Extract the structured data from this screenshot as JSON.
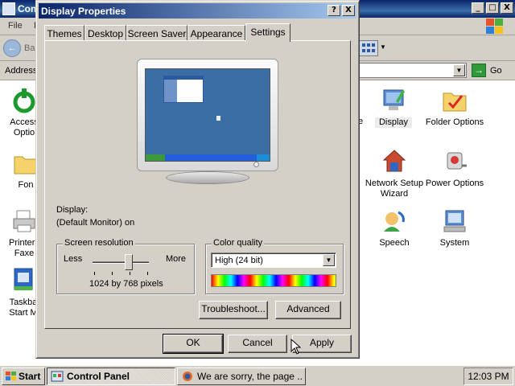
{
  "control_panel": {
    "title": "Contr",
    "menu": {
      "file": "File",
      "edit_fragment": "E"
    },
    "toolbar": {
      "back_label": "Ba"
    },
    "address": {
      "label": "Address",
      "go_label": "Go"
    },
    "items": [
      {
        "key": "accessibility",
        "label_line1": "Access",
        "label_line2": "Optio",
        "icon": "accessibility-icon"
      },
      {
        "key": "fonts",
        "label_line1": "Fon",
        "label_line2": "",
        "icon": "fonts-folder-icon"
      },
      {
        "key": "printers",
        "label_line1": "Printers",
        "label_line2": "Faxe",
        "icon": "printers-icon"
      },
      {
        "key": "taskbar",
        "label_line1": "Taskba",
        "label_line2": "Start M",
        "icon": "taskbar-icon"
      },
      {
        "key": "display",
        "label_line1": "Display",
        "label_line2": "",
        "icon": "display-icon",
        "selected": true
      },
      {
        "key": "folder_options",
        "label_line1": "Folder Options",
        "label_line2": "",
        "icon": "folder-options-icon"
      },
      {
        "key": "network_setup",
        "label_line1": "Network Setup",
        "label_line2": "Wizard",
        "icon": "network-setup-icon"
      },
      {
        "key": "power_options",
        "label_line1": "Power Options",
        "label_line2": "",
        "icon": "power-options-icon"
      },
      {
        "key": "speech",
        "label_line1": "Speech",
        "label_line2": "",
        "icon": "speech-icon"
      },
      {
        "key": "system",
        "label_line1": "System",
        "label_line2": "",
        "icon": "system-icon"
      },
      {
        "key": "partial_e",
        "label_line1": "e",
        "label_line2": "",
        "icon": ""
      }
    ]
  },
  "dialog": {
    "title": "Display Properties",
    "help_btn": "?",
    "close_btn": "X",
    "tabs": [
      "Themes",
      "Desktop",
      "Screen Saver",
      "Appearance",
      "Settings"
    ],
    "active_tab": "Settings",
    "display_label": "Display:",
    "display_value": "(Default Monitor) on",
    "screen_resolution": {
      "legend": "Screen resolution",
      "less": "Less",
      "more": "More",
      "value": "1024 by 768 pixels"
    },
    "color_quality": {
      "legend": "Color quality",
      "selected": "High (24 bit)"
    },
    "buttons": {
      "troubleshoot": "Troubleshoot...",
      "advanced": "Advanced",
      "ok": "OK",
      "cancel": "Cancel",
      "apply": "Apply"
    }
  },
  "window_controls": {
    "minimize": "_",
    "maximize": "□",
    "close": "X"
  },
  "taskbar": {
    "start": "Start",
    "tasks": [
      {
        "label": "Control Panel",
        "active": true
      },
      {
        "label": "We are sorry, the page ...",
        "active": false
      }
    ],
    "clock": "12:03 PM"
  },
  "colors": {
    "titlebar_active": "#0a246a",
    "face": "#d4d0c8",
    "desktop_preview": "#3a6ea5"
  }
}
